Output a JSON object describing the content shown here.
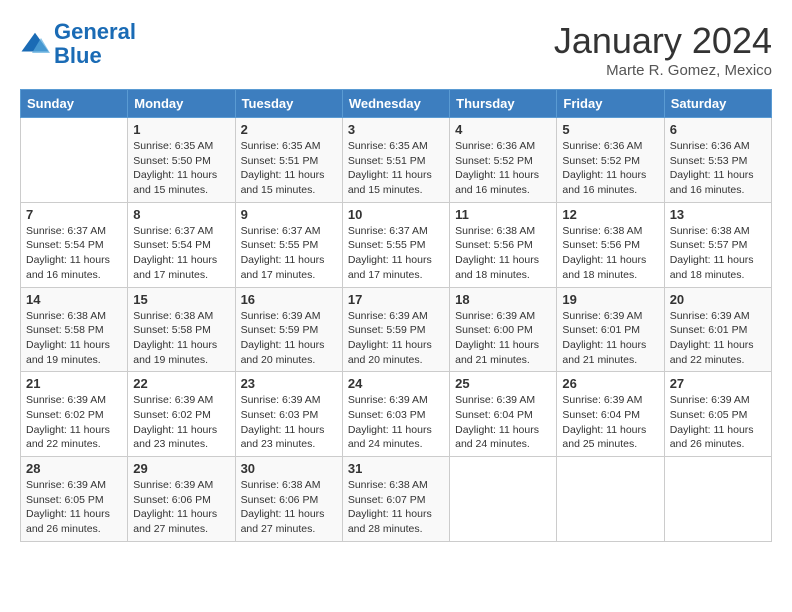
{
  "app": {
    "logo_line1": "General",
    "logo_line2": "Blue"
  },
  "header": {
    "title": "January 2024",
    "location": "Marte R. Gomez, Mexico"
  },
  "weekdays": [
    "Sunday",
    "Monday",
    "Tuesday",
    "Wednesday",
    "Thursday",
    "Friday",
    "Saturday"
  ],
  "weeks": [
    [
      {
        "day": "",
        "info": ""
      },
      {
        "day": "1",
        "info": "Sunrise: 6:35 AM\nSunset: 5:50 PM\nDaylight: 11 hours\nand 15 minutes."
      },
      {
        "day": "2",
        "info": "Sunrise: 6:35 AM\nSunset: 5:51 PM\nDaylight: 11 hours\nand 15 minutes."
      },
      {
        "day": "3",
        "info": "Sunrise: 6:35 AM\nSunset: 5:51 PM\nDaylight: 11 hours\nand 15 minutes."
      },
      {
        "day": "4",
        "info": "Sunrise: 6:36 AM\nSunset: 5:52 PM\nDaylight: 11 hours\nand 16 minutes."
      },
      {
        "day": "5",
        "info": "Sunrise: 6:36 AM\nSunset: 5:52 PM\nDaylight: 11 hours\nand 16 minutes."
      },
      {
        "day": "6",
        "info": "Sunrise: 6:36 AM\nSunset: 5:53 PM\nDaylight: 11 hours\nand 16 minutes."
      }
    ],
    [
      {
        "day": "7",
        "info": "Sunrise: 6:37 AM\nSunset: 5:54 PM\nDaylight: 11 hours\nand 16 minutes."
      },
      {
        "day": "8",
        "info": "Sunrise: 6:37 AM\nSunset: 5:54 PM\nDaylight: 11 hours\nand 17 minutes."
      },
      {
        "day": "9",
        "info": "Sunrise: 6:37 AM\nSunset: 5:55 PM\nDaylight: 11 hours\nand 17 minutes."
      },
      {
        "day": "10",
        "info": "Sunrise: 6:37 AM\nSunset: 5:55 PM\nDaylight: 11 hours\nand 17 minutes."
      },
      {
        "day": "11",
        "info": "Sunrise: 6:38 AM\nSunset: 5:56 PM\nDaylight: 11 hours\nand 18 minutes."
      },
      {
        "day": "12",
        "info": "Sunrise: 6:38 AM\nSunset: 5:56 PM\nDaylight: 11 hours\nand 18 minutes."
      },
      {
        "day": "13",
        "info": "Sunrise: 6:38 AM\nSunset: 5:57 PM\nDaylight: 11 hours\nand 18 minutes."
      }
    ],
    [
      {
        "day": "14",
        "info": "Sunrise: 6:38 AM\nSunset: 5:58 PM\nDaylight: 11 hours\nand 19 minutes."
      },
      {
        "day": "15",
        "info": "Sunrise: 6:38 AM\nSunset: 5:58 PM\nDaylight: 11 hours\nand 19 minutes."
      },
      {
        "day": "16",
        "info": "Sunrise: 6:39 AM\nSunset: 5:59 PM\nDaylight: 11 hours\nand 20 minutes."
      },
      {
        "day": "17",
        "info": "Sunrise: 6:39 AM\nSunset: 5:59 PM\nDaylight: 11 hours\nand 20 minutes."
      },
      {
        "day": "18",
        "info": "Sunrise: 6:39 AM\nSunset: 6:00 PM\nDaylight: 11 hours\nand 21 minutes."
      },
      {
        "day": "19",
        "info": "Sunrise: 6:39 AM\nSunset: 6:01 PM\nDaylight: 11 hours\nand 21 minutes."
      },
      {
        "day": "20",
        "info": "Sunrise: 6:39 AM\nSunset: 6:01 PM\nDaylight: 11 hours\nand 22 minutes."
      }
    ],
    [
      {
        "day": "21",
        "info": "Sunrise: 6:39 AM\nSunset: 6:02 PM\nDaylight: 11 hours\nand 22 minutes."
      },
      {
        "day": "22",
        "info": "Sunrise: 6:39 AM\nSunset: 6:02 PM\nDaylight: 11 hours\nand 23 minutes."
      },
      {
        "day": "23",
        "info": "Sunrise: 6:39 AM\nSunset: 6:03 PM\nDaylight: 11 hours\nand 23 minutes."
      },
      {
        "day": "24",
        "info": "Sunrise: 6:39 AM\nSunset: 6:03 PM\nDaylight: 11 hours\nand 24 minutes."
      },
      {
        "day": "25",
        "info": "Sunrise: 6:39 AM\nSunset: 6:04 PM\nDaylight: 11 hours\nand 24 minutes."
      },
      {
        "day": "26",
        "info": "Sunrise: 6:39 AM\nSunset: 6:04 PM\nDaylight: 11 hours\nand 25 minutes."
      },
      {
        "day": "27",
        "info": "Sunrise: 6:39 AM\nSunset: 6:05 PM\nDaylight: 11 hours\nand 26 minutes."
      }
    ],
    [
      {
        "day": "28",
        "info": "Sunrise: 6:39 AM\nSunset: 6:05 PM\nDaylight: 11 hours\nand 26 minutes."
      },
      {
        "day": "29",
        "info": "Sunrise: 6:39 AM\nSunset: 6:06 PM\nDaylight: 11 hours\nand 27 minutes."
      },
      {
        "day": "30",
        "info": "Sunrise: 6:38 AM\nSunset: 6:06 PM\nDaylight: 11 hours\nand 27 minutes."
      },
      {
        "day": "31",
        "info": "Sunrise: 6:38 AM\nSunset: 6:07 PM\nDaylight: 11 hours\nand 28 minutes."
      },
      {
        "day": "",
        "info": ""
      },
      {
        "day": "",
        "info": ""
      },
      {
        "day": "",
        "info": ""
      }
    ]
  ]
}
